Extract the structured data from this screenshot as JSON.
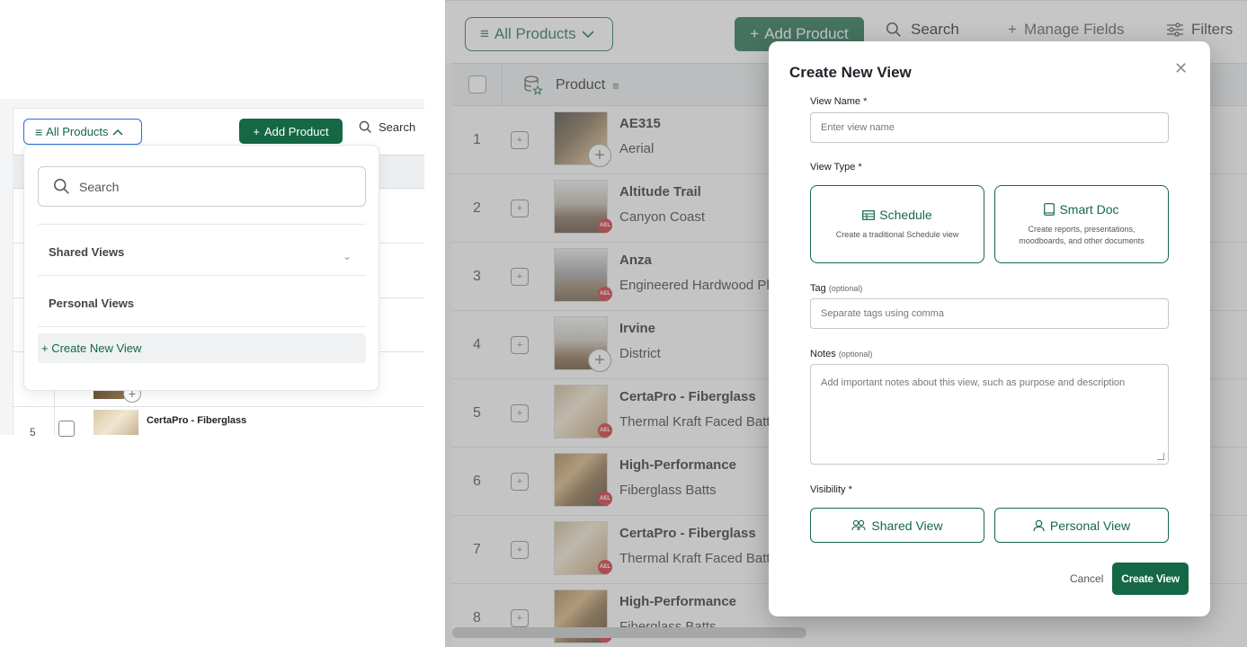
{
  "left_panel": {
    "view_selector_label": "All Products",
    "add_product_label": "Add Product",
    "search_label": "Search",
    "dropdown": {
      "search_placeholder": "Search",
      "shared_views_label": "Shared Views",
      "personal_views_label": "Personal Views",
      "create_new_view_label": "+ Create New View"
    },
    "visible_row": {
      "number": "5",
      "name": "CertaPro - Fiberglass"
    }
  },
  "toolbar": {
    "view_selector_label": "All Products",
    "add_product_label": "Add Product",
    "search_label": "Search",
    "manage_fields_label": "Manage Fields",
    "filters_label": "Filters"
  },
  "table": {
    "column_product_label": "Product",
    "rows": [
      {
        "number": "1",
        "name": "AE315",
        "sub": "Aerial",
        "badge": false
      },
      {
        "number": "2",
        "name": "Altitude Trail",
        "sub": "Canyon Coast",
        "badge": true
      },
      {
        "number": "3",
        "name": "Anza",
        "sub": "Engineered Hardwood Plan",
        "badge": true
      },
      {
        "number": "4",
        "name": "Irvine",
        "sub": "District",
        "badge": false
      },
      {
        "number": "5",
        "name": "CertaPro - Fiberglass",
        "sub": "Thermal Kraft Faced Batts",
        "badge": true
      },
      {
        "number": "6",
        "name": "High-Performance",
        "sub": "Fiberglass Batts",
        "badge": true
      },
      {
        "number": "7",
        "name": "CertaPro - Fiberglass",
        "sub": "Thermal Kraft Faced Batts",
        "badge": true
      },
      {
        "number": "8",
        "name": "High-Performance",
        "sub": "Fiberglass Batts",
        "badge": true
      }
    ],
    "badge_text": "AEL"
  },
  "modal": {
    "title": "Create New View",
    "view_name_label": "View Name *",
    "view_name_placeholder": "Enter view name",
    "view_type_label": "View Type *",
    "schedule_title": "Schedule",
    "schedule_desc": "Create a traditional Schedule view",
    "smartdoc_title": "Smart Doc",
    "smartdoc_desc": "Create reports, presentations, moodboards, and other documents",
    "tag_label": "Tag",
    "tag_optional": "(optional)",
    "tag_placeholder": "Separate tags using comma",
    "notes_label": "Notes",
    "notes_optional": "(optional)",
    "notes_placeholder": "Add important notes about this view, such as purpose and description",
    "visibility_label": "Visibility *",
    "shared_view_label": "Shared View",
    "personal_view_label": "Personal View",
    "cancel_label": "Cancel",
    "create_label": "Create View"
  },
  "colors": {
    "brand_green": "#156845",
    "focus_blue": "#2a6fdb",
    "badge_red": "#d2232a"
  }
}
